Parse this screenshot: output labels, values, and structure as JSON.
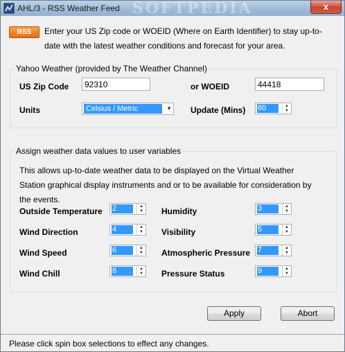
{
  "window": {
    "title": "AHL/3 - RSS Weather Feed",
    "watermark": "SOFTPEDIA",
    "close_label": "x"
  },
  "intro": {
    "rss_badge": "RSS",
    "text": "Enter your US Zip code or WOEID (Where on Earth Identifier) to stay up-to-date with the latest weather conditions and forecast for your area."
  },
  "yahoo": {
    "group_title": "Yahoo Weather (provided by The Weather Channel)",
    "zip_label": "US Zip Code",
    "zip_value": "92310",
    "woeid_label": "or WOEID",
    "woeid_value": "44418",
    "units_label": "Units",
    "units_value": "Celsius / Metric",
    "update_label": "Update (Mins)",
    "update_value": "60"
  },
  "assign": {
    "group_title": "Assign weather data values to user variables",
    "description": "This allows up-to-date weather data to be displayed on the Virtual Weather Station graphical display instruments and or to be available for consideration by the events.",
    "fields": [
      {
        "label": "Outside Temperature",
        "value": "2"
      },
      {
        "label": "Humidity",
        "value": "3"
      },
      {
        "label": "Wind Direction",
        "value": "4"
      },
      {
        "label": "Visibility",
        "value": "5"
      },
      {
        "label": "Wind Speed",
        "value": "6"
      },
      {
        "label": "Atmospheric Pressure",
        "value": "7"
      },
      {
        "label": "Wind Chill",
        "value": "8"
      },
      {
        "label": "Pressure Status",
        "value": "9"
      }
    ]
  },
  "buttons": {
    "apply": "Apply",
    "abort": "Abort"
  },
  "status": {
    "text": "Please click spin box selections to effect any changes."
  }
}
